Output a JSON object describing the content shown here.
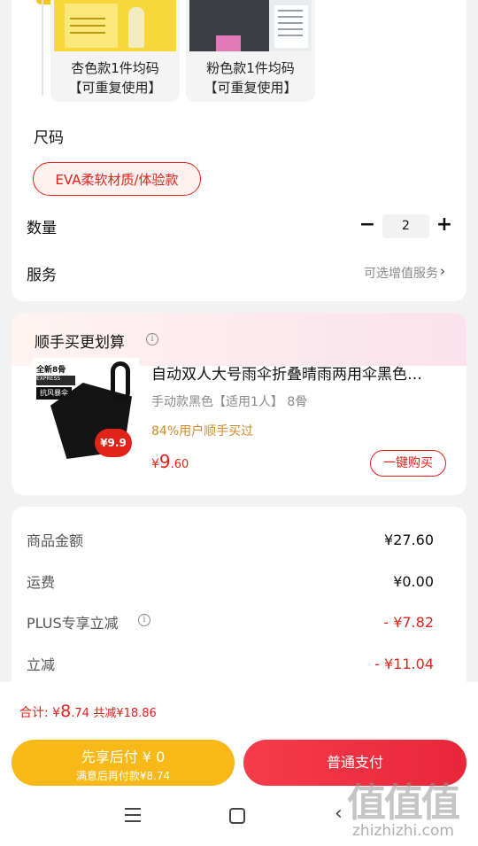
{
  "variants": [
    {
      "line1": "杏色款1件均码",
      "line2": "【可重复使用】"
    },
    {
      "line1": "粉色款1件均码",
      "line2": "【可重复使用】"
    }
  ],
  "size": {
    "title": "尺码",
    "option": "EVA柔软材质/体验款"
  },
  "quantity": {
    "label": "数量",
    "minus": "−",
    "value": "2",
    "plus": "+"
  },
  "service": {
    "label": "服务",
    "value": "可选增值服务",
    "chevron": "›"
  },
  "addon": {
    "title": "顺手买更划算",
    "image_text": {
      "tag1": "全新8骨",
      "tag2": "EXPRESS",
      "tag3": "抗风暴伞",
      "badge": "¥9.9"
    },
    "name": "自动双人大号雨伞折叠晴雨两用伞黑色…",
    "spec": "手动款黑色【适用1人】 8骨",
    "rate": "84%用户顺手买过",
    "price_symbol": "¥",
    "price_int": "9",
    "price_dec": ".60",
    "buy_label": "一键购买"
  },
  "price_rows": [
    {
      "label": "商品金额",
      "value": "¥27.60"
    },
    {
      "label": "运费",
      "value": "¥0.00"
    },
    {
      "label": "PLUS专享立减",
      "value": "- ¥7.82"
    },
    {
      "label": "立减",
      "value": "- ¥11.04"
    }
  ],
  "bottom": {
    "total_prefix": "合计:",
    "total_sym": "¥",
    "total_int": "8",
    "total_dec": ".74",
    "saved": "共减¥18.86",
    "later_line1": "先享后付 ¥ 0",
    "later_line2": "满意后再付款¥8.74",
    "pay_label": "普通支付"
  },
  "watermark": {
    "main": "值值值",
    "sub": "zhizhizhi.com"
  },
  "colors": {
    "accent_red": "#e2231a",
    "later_yellow": "#f8b818",
    "rate_orange": "#d08a2a"
  }
}
